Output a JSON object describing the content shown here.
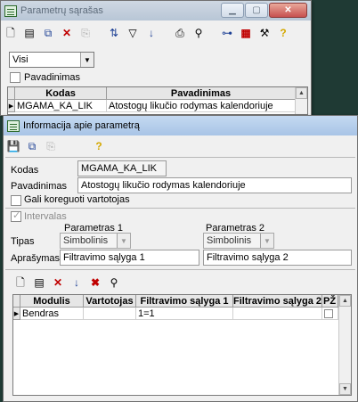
{
  "back_window": {
    "title": "Parametrų sąrašas",
    "toolbar_icons": [
      "new-doc-icon",
      "open-doc-icon",
      "copy-structure-icon",
      "delete-icon",
      "copy-icon",
      "sort-tree-icon",
      "filter-icon",
      "sort-az-icon",
      "print-icon",
      "find-icon",
      "hierarchy-icon",
      "grid-icon",
      "tools-icon",
      "help-icon"
    ],
    "filter_select": "Visi",
    "checkbox_label": "Pavadinimas",
    "table": {
      "headers": [
        "Kodas",
        "Pavadinimas"
      ],
      "rows": [
        [
          "MGAMA_KA_LIK",
          "Atostogų likučio rodymas kalendoriuje"
        ]
      ]
    }
  },
  "front_window": {
    "title": "Informacija apie parametrą",
    "toolbar_icons": [
      "save-icon",
      "copy-structure-icon",
      "copy-icon",
      "help-icon"
    ],
    "kodas_label": "Kodas",
    "kodas_value": "MGAMA_KA_LIK",
    "pavadinimas_label": "Pavadinimas",
    "pavadinimas_value": "Atostogų likučio rodymas kalendoriuje",
    "editable_label": "Gali koreguoti vartotojas",
    "interval_label": "Intervalas",
    "param1_label": "Parametras 1",
    "param2_label": "Parametras 2",
    "tipas_label": "Tipas",
    "tipas1": "Simbolinis",
    "tipas2": "Simbolinis",
    "aprasymas_label": "Aprašymas",
    "aprasymas1": "Filtravimo sąlyga 1",
    "aprasymas2": "Filtravimo sąlyga 2",
    "grid_toolbar_icons": [
      "new-doc-icon",
      "open-doc-icon",
      "delete-icon",
      "sort-az-icon",
      "delete-all-icon",
      "find-icon"
    ],
    "grid": {
      "headers": [
        "Modulis",
        "Vartotojas",
        "Filtravimo sąlyga 1",
        "Filtravimo sąlyga 2",
        "PŽ"
      ],
      "rows": [
        [
          "Bendras",
          "",
          "1=1",
          "",
          ""
        ]
      ]
    }
  }
}
